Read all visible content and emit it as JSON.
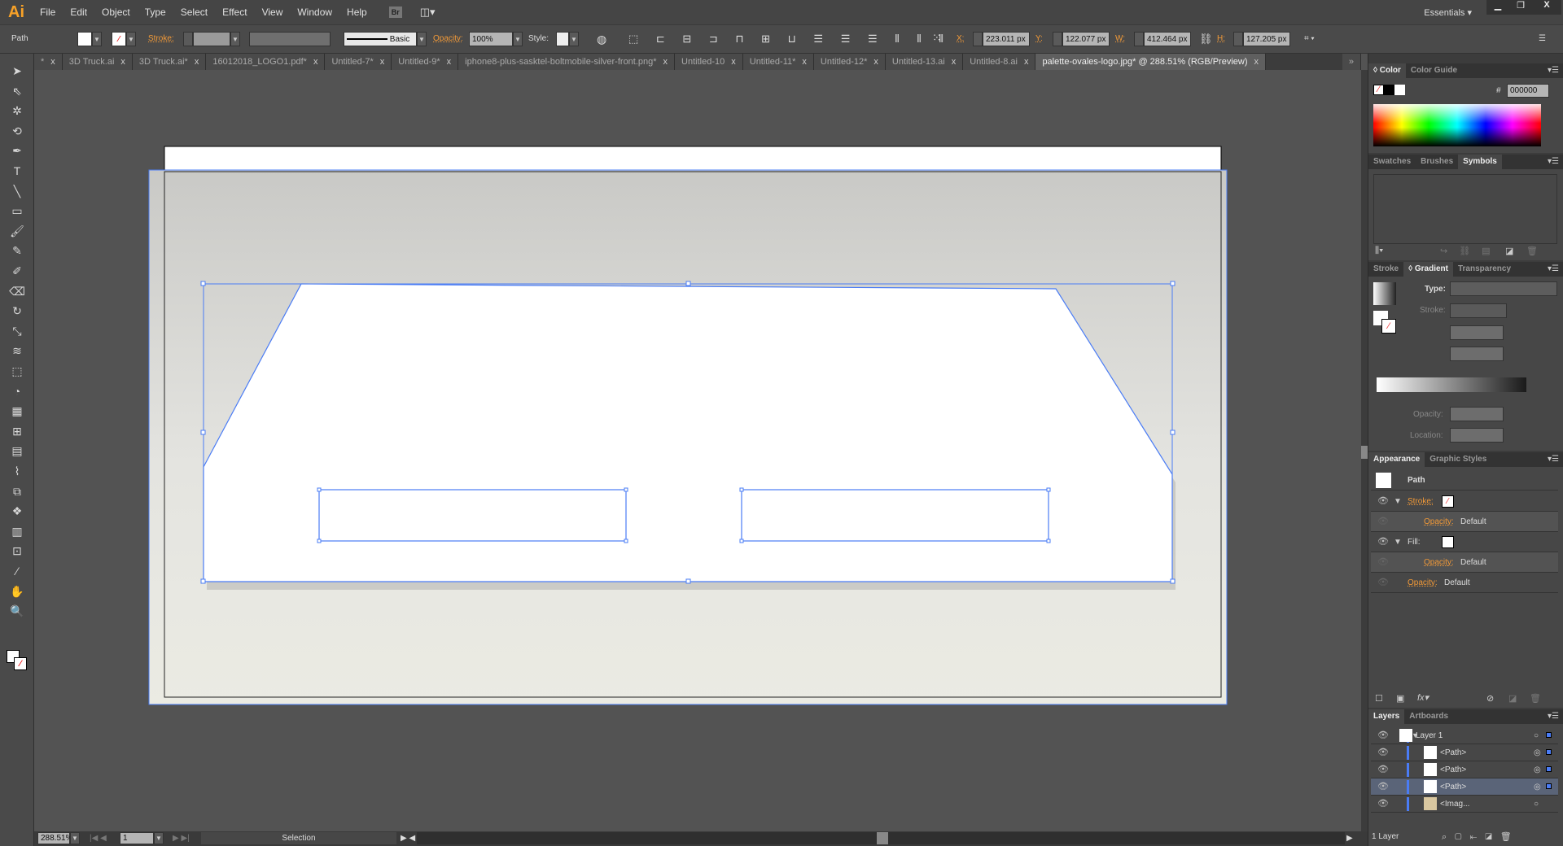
{
  "app": {
    "logo": "Ai",
    "menus": [
      "File",
      "Edit",
      "Object",
      "Type",
      "Select",
      "Effect",
      "View",
      "Window",
      "Help"
    ],
    "bridge": "Br",
    "workspace": "Essentials",
    "window_controls": [
      "minimize",
      "restore",
      "close"
    ]
  },
  "control": {
    "selection": "Path",
    "stroke_label": "Stroke:",
    "brush": "Basic",
    "opacity_label": "Opacity:",
    "opacity": "100%",
    "style_label": "Style:",
    "x_label": "X:",
    "x": "223.011 px",
    "y_label": "Y:",
    "y": "122.077 px",
    "w_label": "W:",
    "w": "412.464 px",
    "h_label": "H:",
    "h": "127.205 px"
  },
  "tabs": [
    {
      "label": "*"
    },
    {
      "label": "3D Truck.ai"
    },
    {
      "label": "3D Truck.ai*"
    },
    {
      "label": "16012018_LOGO1.pdf*"
    },
    {
      "label": "Untitled-7*"
    },
    {
      "label": "Untitled-9*"
    },
    {
      "label": "iphone8-plus-sasktel-boltmobile-silver-front.png*"
    },
    {
      "label": "Untitled-10"
    },
    {
      "label": "Untitled-11*"
    },
    {
      "label": "Untitled-12*"
    },
    {
      "label": "Untitled-13.ai"
    },
    {
      "label": "Untitled-8.ai"
    },
    {
      "label": "palette-ovales-logo.jpg* @ 288.51% (RGB/Preview)",
      "active": true
    }
  ],
  "status": {
    "zoom": "288.51%",
    "artboard": "1",
    "tool": "Selection"
  },
  "color_panel": {
    "tabs": [
      "Color",
      "Color Guide"
    ],
    "hex_label": "#",
    "hex": "000000"
  },
  "symbols_panel": {
    "tabs": [
      "Swatches",
      "Brushes",
      "Symbols"
    ]
  },
  "gradient_panel": {
    "tabs": [
      "Stroke",
      "Gradient",
      "Transparency"
    ],
    "type_label": "Type:",
    "stroke_label": "Stroke:",
    "opacity_label": "Opacity:",
    "location_label": "Location:"
  },
  "appearance_panel": {
    "tabs": [
      "Appearance",
      "Graphic Styles"
    ],
    "title": "Path",
    "stroke_label": "Stroke:",
    "fill_label": "Fill:",
    "opacity_label": "Opacity:",
    "default": "Default"
  },
  "layers_panel": {
    "tabs": [
      "Layers",
      "Artboards"
    ],
    "layer": "Layer 1",
    "items": [
      "<Path>",
      "<Path>",
      "<Path>",
      "<Imag..."
    ],
    "footer": "1 Layer"
  },
  "colors": {
    "accent": "#4a7cf5",
    "orange": "#f29a38"
  }
}
